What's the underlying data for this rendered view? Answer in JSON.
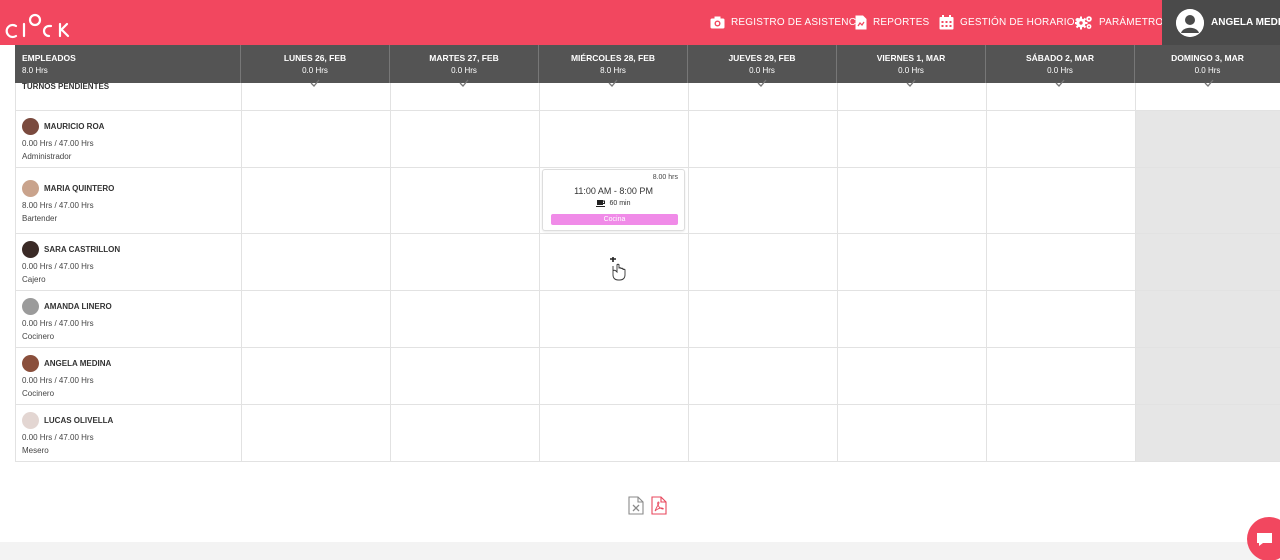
{
  "app": {
    "logo_text": "CLOCK",
    "accent_color": "#f2475f",
    "header_bg": "#545454"
  },
  "nav": {
    "items": [
      {
        "label": "REGISTRO DE ASISTENCIA",
        "icon": "camera-icon"
      },
      {
        "label": "REPORTES",
        "icon": "report-icon"
      },
      {
        "label": "GESTIÓN DE HORARIOS",
        "icon": "calendar-icon"
      },
      {
        "label": "PARÁMETROS",
        "icon": "gears-icon"
      }
    ],
    "user": {
      "name": "ANGELA MEDINA",
      "icon": "user-icon"
    }
  },
  "schedule": {
    "employees_header": {
      "label": "EMPLEADOS",
      "total": "8.0 Hrs"
    },
    "days": [
      {
        "label": "LUNES 26, FEB",
        "hours": "0.0 Hrs"
      },
      {
        "label": "MARTES 27, FEB",
        "hours": "0.0 Hrs"
      },
      {
        "label": "MIÉRCOLES 28, FEB",
        "hours": "8.0 Hrs"
      },
      {
        "label": "JUEVES 29, FEB",
        "hours": "0.0 Hrs"
      },
      {
        "label": "VIERNES 1, MAR",
        "hours": "0.0 Hrs"
      },
      {
        "label": "SÁBADO 2, MAR",
        "hours": "0.0 Hrs"
      },
      {
        "label": "DOMINGO 3, MAR",
        "hours": "0.0 Hrs"
      }
    ],
    "pending_label": "TURNOS PENDIENTES",
    "employees": [
      {
        "name": "MAURICIO ROA",
        "hours": "0.00 Hrs / 47.00 Hrs",
        "role": "Administrador"
      },
      {
        "name": "MARIA QUINTERO",
        "hours": "8.00 Hrs / 47.00 Hrs",
        "role": "Bartender"
      },
      {
        "name": "SARA CASTRILLON",
        "hours": "0.00 Hrs / 47.00 Hrs",
        "role": "Cajero"
      },
      {
        "name": "AMANDA LINERO",
        "hours": "0.00 Hrs / 47.00 Hrs",
        "role": "Cocinero"
      },
      {
        "name": "ANGELA MEDINA",
        "hours": "0.00 Hrs / 47.00 Hrs",
        "role": "Cocinero"
      },
      {
        "name": "LUCAS OLIVELLA",
        "hours": "0.00 Hrs / 47.00 Hrs",
        "role": "Mesero"
      }
    ],
    "shift": {
      "duration": "8.00 hrs",
      "time": "11:00 AM - 8:00 PM",
      "break": "60 min",
      "area": "Cocina",
      "area_color": "#f08be8"
    }
  },
  "export": {
    "excel_icon": "excel-file-icon",
    "pdf_icon": "pdf-file-icon"
  }
}
